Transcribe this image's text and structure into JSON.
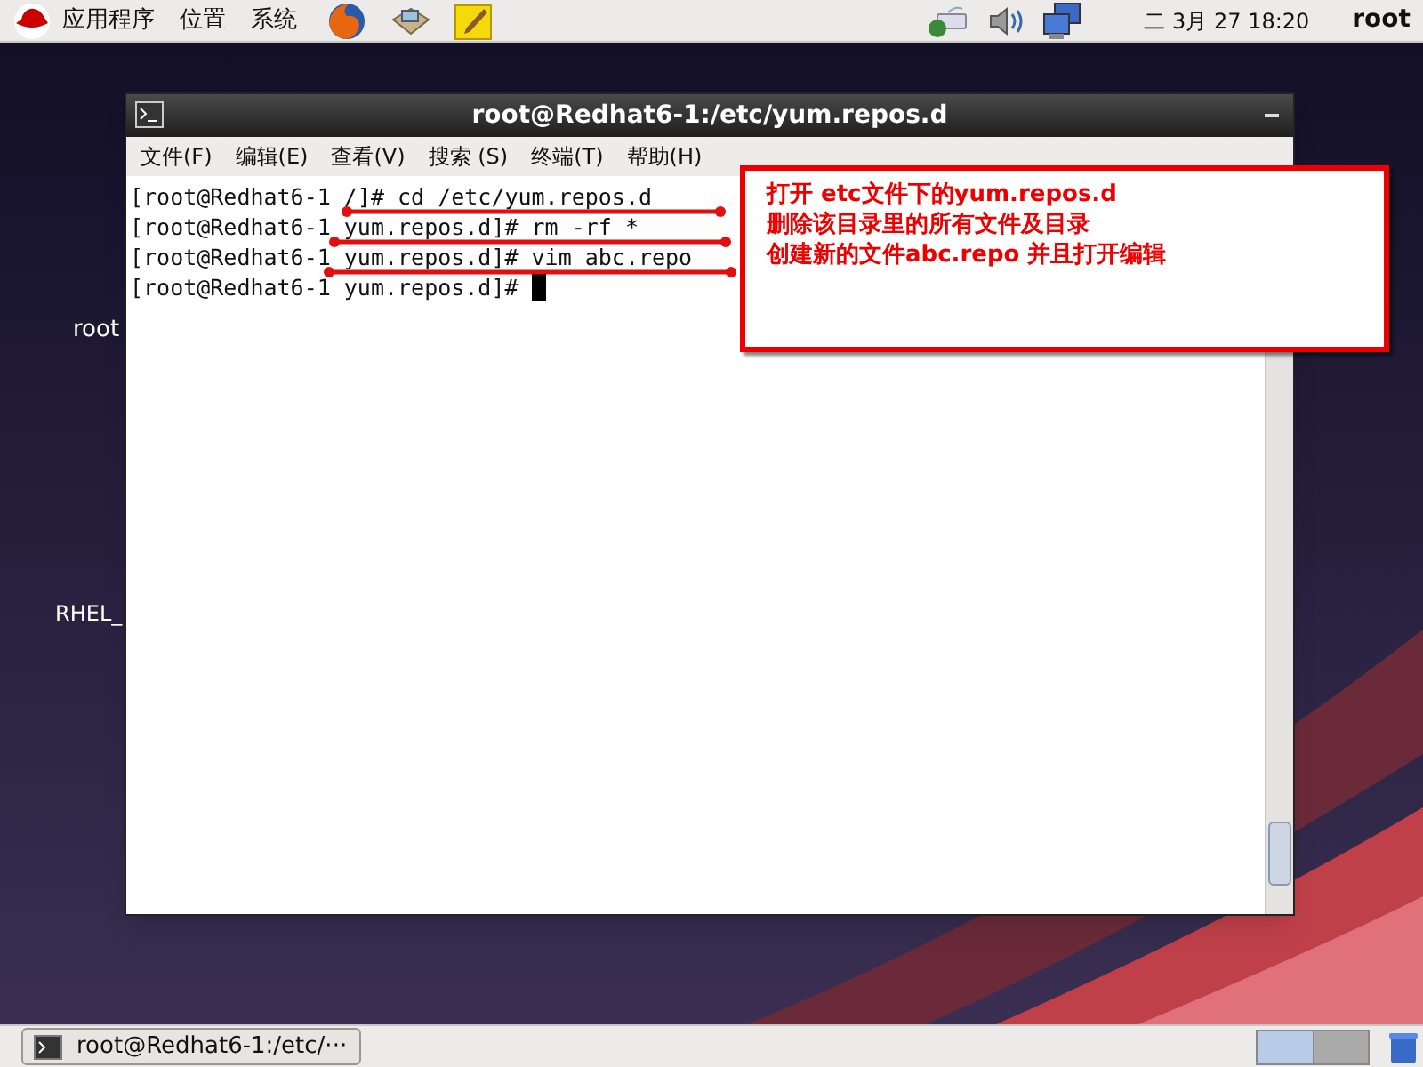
{
  "top_panel": {
    "menus": [
      "应用程序",
      "位置",
      "系统"
    ],
    "clock": "二 3月 27 18:20",
    "user": "root"
  },
  "desktop_icons": [
    {
      "label": "root"
    },
    {
      "label": "RHEL_"
    }
  ],
  "terminal": {
    "title": "root@Redhat6-1:/etc/yum.repos.d",
    "menu": [
      "文件(F)",
      "编辑(E)",
      "查看(V)",
      "搜索 (S)",
      "终端(T)",
      "帮助(H)"
    ],
    "lines": [
      {
        "text": "[root@Redhat6-1 /]# cd /etc/yum.repos.d"
      },
      {
        "text": "[root@Redhat6-1 yum.repos.d]# rm -rf *"
      },
      {
        "text": "[root@Redhat6-1 yum.repos.d]# vim abc.repo"
      },
      {
        "text": "[root@Redhat6-1 yum.repos.d]# ",
        "cursor": true
      }
    ]
  },
  "annotation": {
    "lines": [
      "打开 etc文件下的yum.repos.d",
      "删除该目录里的所有文件及目录",
      "创建新的文件abc.repo 并且打开编辑"
    ]
  },
  "taskbar": {
    "tasks": [
      {
        "label": "root@Redhat6-1:/etc/···",
        "selected": false
      }
    ]
  }
}
